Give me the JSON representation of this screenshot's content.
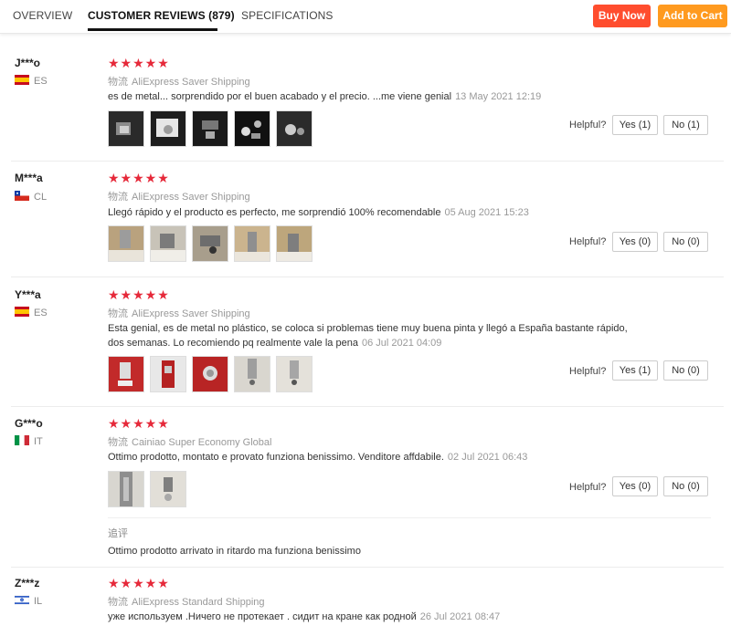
{
  "tabs": {
    "overview": "OVERVIEW",
    "reviews": "CUSTOMER REVIEWS (879)",
    "specifications": "SPECIFICATIONS"
  },
  "buttons": {
    "buy_now": "Buy Now",
    "add_to_cart": "Add to Cart"
  },
  "helpful_label": "Helpful?",
  "shipping_prefix": "物流",
  "rating_stars": "★★★★★",
  "reviews": [
    {
      "user": "J***o",
      "country": "ES",
      "flag": "es-flag-icon",
      "shipping": "AliExpress Saver Shipping",
      "text": "es de metal... sorprendido por el buen acabado y el precio. ...me viene genial",
      "date": "13 May 2021 12:19",
      "yes": "Yes (1)",
      "no": "No (1)"
    },
    {
      "user": "M***a",
      "country": "CL",
      "flag": "cl-flag-icon",
      "shipping": "AliExpress Saver Shipping",
      "text": "Llegó rápido y el producto es perfecto, me sorprendió 100% recomendable",
      "date": "05 Aug 2021 15:23",
      "yes": "Yes (0)",
      "no": "No (0)"
    },
    {
      "user": "Y***a",
      "country": "ES",
      "flag": "es-flag-icon",
      "shipping": "AliExpress Saver Shipping",
      "text_line1": "Esta genial, es de metal no plástico, se coloca si problemas tiene muy buena pinta y llegó a España bastante rápido,",
      "text_line2": "dos semanas. Lo recomiendo pq realmente vale la pena",
      "date": "06 Jul 2021 04:09",
      "yes": "Yes (1)",
      "no": "No (0)"
    },
    {
      "user": "G***o",
      "country": "IT",
      "flag": "it-flag-icon",
      "shipping": "Cainiao Super Economy Global",
      "text": "Ottimo prodotto, montato e provato funziona benissimo. Venditore affdabile.",
      "date": "02 Jul 2021 06:43",
      "yes": "Yes (0)",
      "no": "No (0)",
      "followup_label": "追评",
      "followup_text": "Ottimo prodotto arrivato in ritardo ma funziona benissimo"
    },
    {
      "user": "Z***z",
      "country": "IL",
      "flag": "il-flag-icon",
      "shipping": "AliExpress Standard Shipping",
      "text": "уже используем .Ничего не протекает . сидит на кране как родной",
      "date": "26 Jul 2021 08:47"
    }
  ],
  "colors": {
    "buy_now": "#ff4d2e",
    "add_to_cart": "#ff9a1f",
    "stars": "#e6293a"
  }
}
